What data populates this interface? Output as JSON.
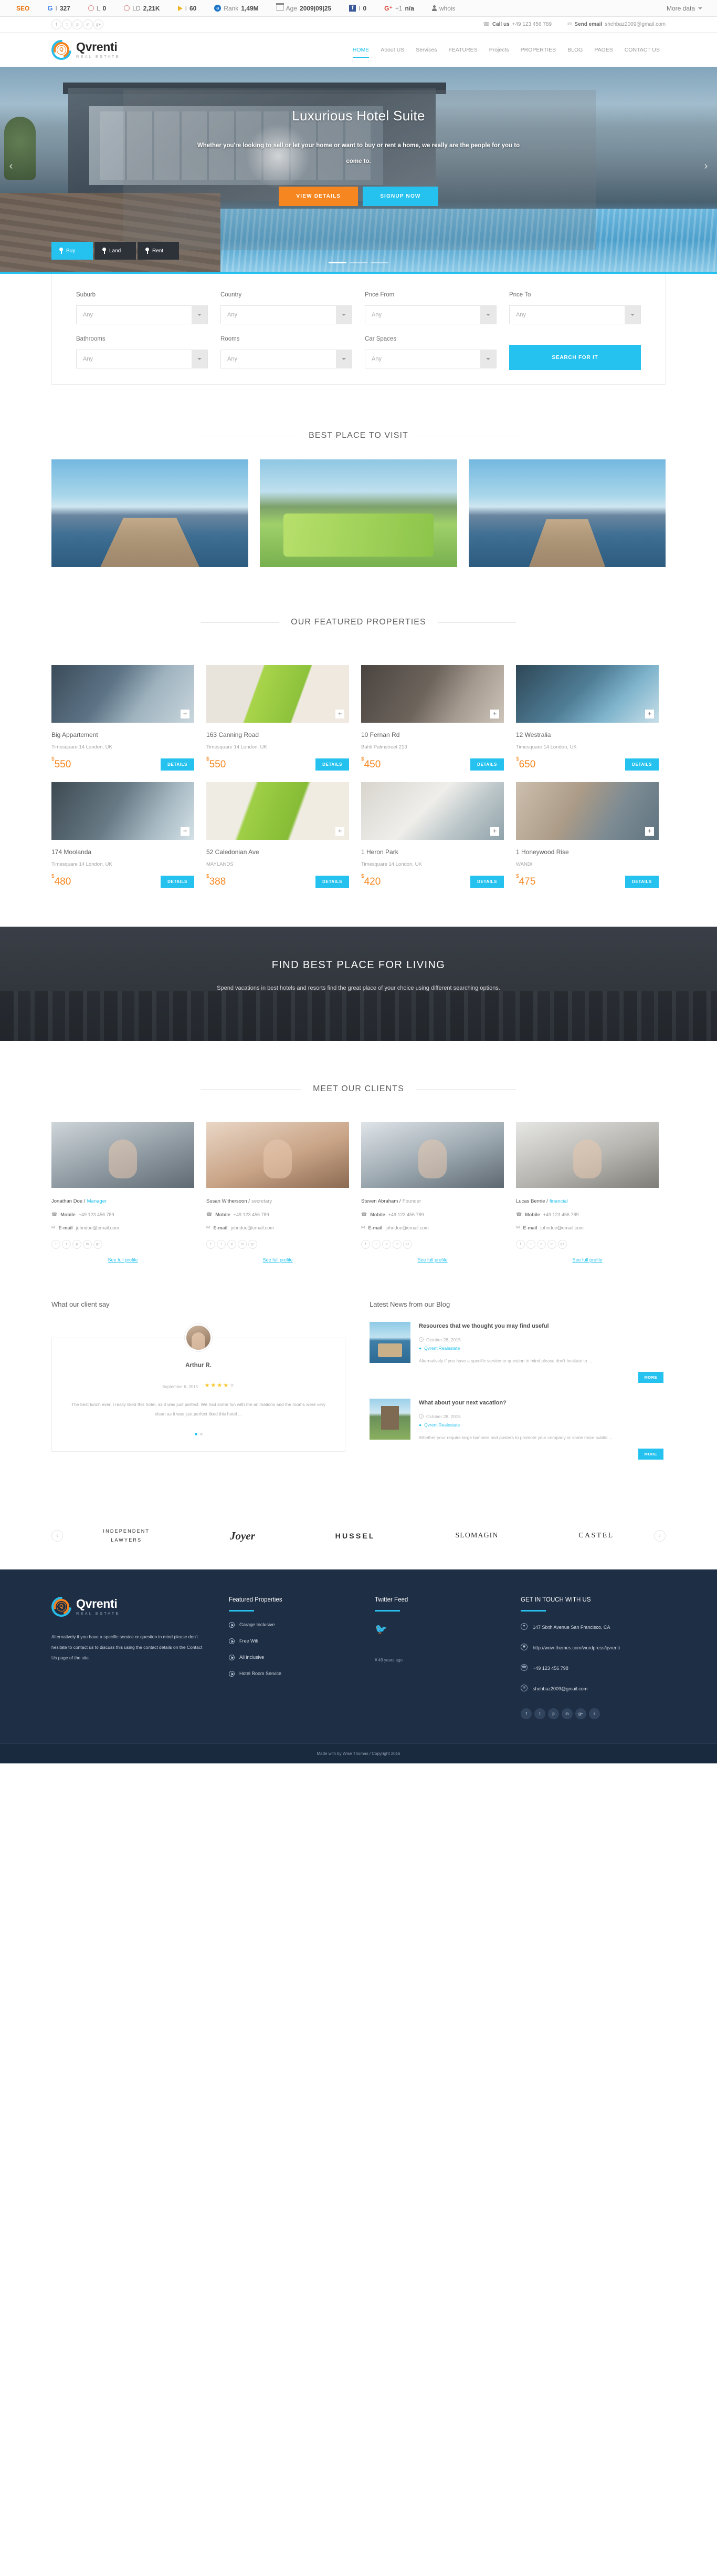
{
  "seobar": {
    "items": [
      {
        "icon": "seo-logo",
        "label": "",
        "value": ""
      },
      {
        "icon": "google-icon",
        "label": "I",
        "value": "327"
      },
      {
        "icon": "moz-link-icon",
        "label": "L",
        "value": "0"
      },
      {
        "icon": "moz-domain-icon",
        "label": "LD",
        "value": "2,21K"
      },
      {
        "icon": "play-icon",
        "label": "I",
        "value": "60"
      },
      {
        "icon": "alexa-icon",
        "label": "Rank",
        "value": "1,49M"
      },
      {
        "icon": "bank-icon",
        "label": "Age",
        "value": "2009|09|25"
      },
      {
        "icon": "facebook-icon",
        "label": "I",
        "value": "0"
      },
      {
        "icon": "google-plus-icon",
        "label": "+1",
        "value": "n/a"
      },
      {
        "icon": "person-icon",
        "label": "whois",
        "value": ""
      }
    ],
    "more_label": "More data"
  },
  "topbar": {
    "social": [
      "f",
      "t",
      "p",
      "in",
      "g+"
    ],
    "call_label": "Call us",
    "call_value": "+49 123 456 789",
    "email_label": "Send email",
    "email_value": "shehbaz2009@gmail.com"
  },
  "brand": {
    "name": "Qvrenti",
    "tagline": "REAL ESTATE",
    "mark_letter": "Q"
  },
  "nav": {
    "items": [
      {
        "label": "HOME",
        "active": true
      },
      {
        "label": "About US",
        "active": false
      },
      {
        "label": "Services",
        "active": false
      },
      {
        "label": "FEATURES",
        "active": false
      },
      {
        "label": "Projects",
        "active": false
      },
      {
        "label": "PROPERTIES",
        "active": false
      },
      {
        "label": "BLOG",
        "active": false
      },
      {
        "label": "PAGES",
        "active": false
      },
      {
        "label": "CONTACT US",
        "active": false
      }
    ]
  },
  "hero": {
    "title": "Luxurious Hotel Suite",
    "subtitle": "Whether you're looking to sell or let your home or want to buy or rent a home, we really are the people for you to come to.",
    "btn_primary": "VIEW DETAILS",
    "btn_secondary": "SIGNUP NOW",
    "prev_icon": "chevron-left-icon",
    "next_icon": "chevron-right-icon"
  },
  "search": {
    "tabs": [
      {
        "label": "Buy",
        "active": true
      },
      {
        "label": "Land",
        "active": false
      },
      {
        "label": "Rent",
        "active": false
      }
    ],
    "fields_row1": [
      {
        "label": "Suburb",
        "value": "Any"
      },
      {
        "label": "Country",
        "value": "Any"
      },
      {
        "label": "Price From",
        "value": "Any"
      },
      {
        "label": "Price To",
        "value": "Any"
      }
    ],
    "fields_row2": [
      {
        "label": "Bathrooms",
        "value": "Any"
      },
      {
        "label": "Rooms",
        "value": "Any"
      },
      {
        "label": "Car Spaces",
        "value": "Any"
      }
    ],
    "button": "SEARCH FOR IT"
  },
  "best_place": {
    "title": "BEST PLACE TO VISIT"
  },
  "featured": {
    "title": "OUR FEATURED PROPERTIES",
    "details_label": "DETAILS",
    "currency": "$",
    "properties": [
      {
        "name": "Big Appartement",
        "address": "Timesquare 14 London, UK",
        "price": "550"
      },
      {
        "name": "163 Canning Road",
        "address": "Timesquare 14 London, UK",
        "price": "550"
      },
      {
        "name": "10 Fernan Rd",
        "address": "Bahli Palmstreet 213",
        "price": "450"
      },
      {
        "name": "12 Westralia",
        "address": "Timesquare 14 London, UK",
        "price": "650"
      },
      {
        "name": "174 Moolanda",
        "address": "Timesquare 14 London, UK",
        "price": "480"
      },
      {
        "name": "52 Caledonian Ave",
        "address": "MAYLANDS",
        "price": "388"
      },
      {
        "name": "1 Heron Park",
        "address": "Timesquare 14 London, UK",
        "price": "420"
      },
      {
        "name": "1 Honeywood Rise",
        "address": "WANDI",
        "price": "475"
      }
    ]
  },
  "find_best": {
    "title": "FIND BEST PLACE FOR LIVING",
    "subtitle": "Spend vacations in best hotels and resorts find the great place of your choice using different searching options."
  },
  "clients": {
    "title": "MEET OUR CLIENTS",
    "mobile_label": "Mobile",
    "email_label": "E-mail",
    "profile_link": "See full profile",
    "social": [
      "f",
      "t",
      "p",
      "in",
      "g+"
    ],
    "people": [
      {
        "name": "Jonathan Doe /",
        "role": "Manager",
        "role_color": "hl",
        "mobile": "+49 123 456 789",
        "email": "johndoe@email.com"
      },
      {
        "name": "Susan Withersoon /",
        "role": "secretary",
        "role_color": "gy",
        "mobile": "+49 123 456 789",
        "email": "johndoe@email.com"
      },
      {
        "name": "Steven Abraham /",
        "role": "Founder",
        "role_color": "gy",
        "mobile": "+49 123 456 789",
        "email": "johndoe@email.com"
      },
      {
        "name": "Lucas Bernie /",
        "role": "financial",
        "role_color": "hl",
        "mobile": "+49 123 456 789",
        "email": "johndoe@email.com"
      }
    ]
  },
  "testimonial": {
    "heading": "What our client say",
    "author": "Arthur R.",
    "date": "September 6, 2015",
    "stars": 4,
    "stars_total": 5,
    "text": "The best lunch ever. I really liked this hotel, as it was just perfect. We had some fun with the animations and the rooms were very clean as it was just perfect liked this hotel ...",
    "dots": 2,
    "active_dot": 0
  },
  "blog": {
    "heading": "Latest News from our Blog",
    "more_label": "MORE",
    "posts": [
      {
        "title": "Resources that we thought you may find useful",
        "date": "October 28, 2015",
        "author": "QvrentiRealestate",
        "text": "Alternatively if you have a specific service or question in mind please don't hesitate to ..."
      },
      {
        "title": "What about your next vacation?",
        "date": "October 28, 2015",
        "author": "QvrentiRealestate",
        "text": "Whether your require large banners and posters to promote your company or some more subtle ..."
      }
    ]
  },
  "partners": {
    "prev_icon": "chevron-left-icon",
    "next_icon": "chevron-right-icon",
    "items": [
      {
        "line1": "INDEPENDENT",
        "line2": "LAWYERS",
        "style": "p1"
      },
      {
        "line1": "Joyer",
        "line2": "",
        "style": "p2"
      },
      {
        "line1": "HUSSEL",
        "line2": "",
        "style": "p3"
      },
      {
        "line1": "SLOMAGIN",
        "line2": "",
        "style": "p4"
      },
      {
        "line1": "CASTEL",
        "line2": "",
        "style": "p5"
      }
    ]
  },
  "footer": {
    "about": "Alternatively if you have a specific service or question in mind please don't hesitate to contact us to discuss this using the contact details on the Contact Us page of the site.",
    "col_featured": {
      "heading": "Featured Properties",
      "items": [
        "Garage Inclusive",
        "Free Wifi",
        "All inclusive",
        "Hotel Room Service"
      ]
    },
    "col_twitter": {
      "heading": "Twitter Feed",
      "icon": "twitter-icon",
      "ago": "# 49 years ago"
    },
    "col_contact": {
      "heading": "GET IN TOUCH WITH US",
      "address": "147 Sixth Avenue San Francisco, CA",
      "website": "http://wow-themes.com/wordpress/qvrenti",
      "phone": "+49 123 456 798",
      "email": "shehbaz2009@gmail.com",
      "social": [
        "f",
        "t",
        "p",
        "in",
        "g+",
        "rss"
      ]
    },
    "bottom": "Made with  by Wise Thomas / Copyright 2016"
  }
}
